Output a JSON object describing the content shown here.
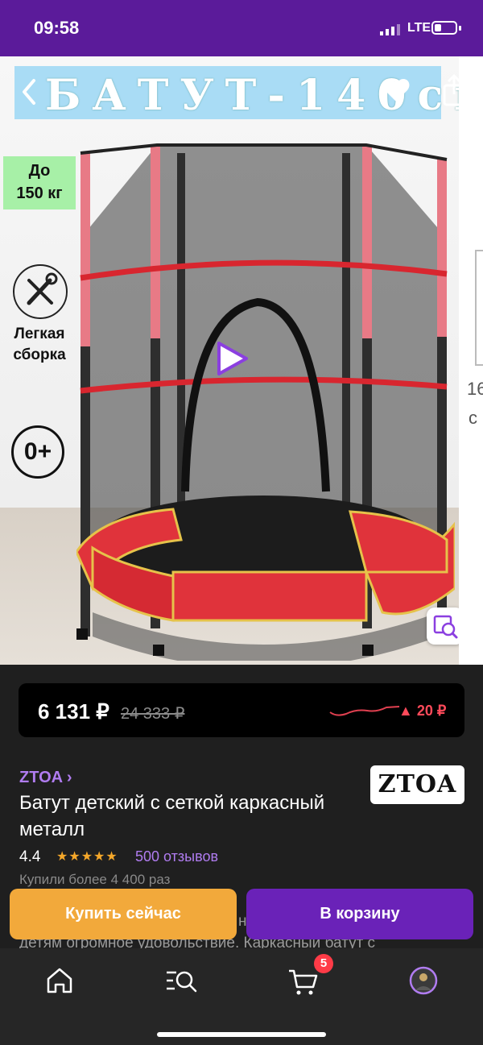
{
  "status_bar": {
    "time": "09:58",
    "network": "LTE"
  },
  "gallery": {
    "title_banner": "БАТУТ-140см",
    "weight_badge": [
      "До",
      "150 кг"
    ],
    "assembly_label": [
      "Легкая",
      "сборка"
    ],
    "age_badge": "0+",
    "next_image_text": [
      "16",
      "с"
    ]
  },
  "price_card": {
    "price": "6 131 ₽",
    "old_price": "24 333 ₽",
    "delta": "▲ 20 ₽",
    "colors": {
      "delta": "#ff4a5a",
      "trend_line": "#e04050"
    }
  },
  "product": {
    "brand": "ZTOA ›",
    "brand_logo": "ZTOA",
    "title": "Батут детский с сеткой каркасный металл",
    "rating": "4.4",
    "stars": "★★★★★",
    "reviews": "500 отзывов",
    "bought": "Купили более 4 400 раз",
    "description_partial": "детям огромное удовольствие. Каркасный батут с",
    "description_cut": "н"
  },
  "actions": {
    "buy_now": "Купить сейчас",
    "add_to_cart": "В корзину",
    "colors": {
      "buy_now": "#f2a93b",
      "add_to_cart": "#6a22b8"
    }
  },
  "tabbar": {
    "items": [
      {
        "name": "home",
        "icon": "home-icon"
      },
      {
        "name": "catalog",
        "icon": "catalog-search-icon"
      },
      {
        "name": "cart",
        "icon": "cart-icon"
      },
      {
        "name": "profile",
        "icon": "avatar-icon"
      }
    ],
    "cart_count": "5"
  },
  "colors": {
    "accent": "#5b1b9a",
    "brand_purple": "#b07cf0"
  }
}
